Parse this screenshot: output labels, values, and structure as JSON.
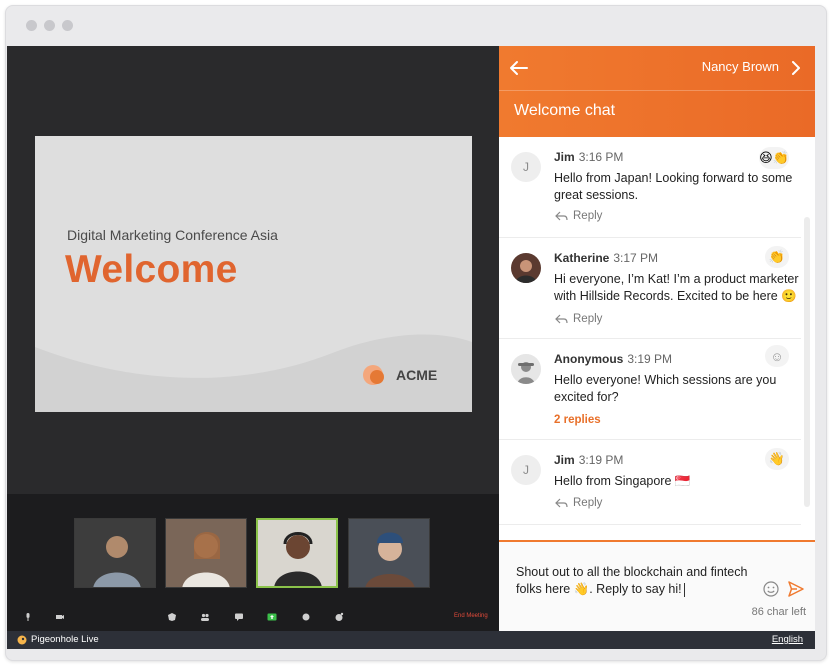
{
  "slide": {
    "subtitle": "Digital Marketing Conference Asia",
    "title": "Welcome",
    "logo_text": "ACME"
  },
  "controls": {
    "end_meeting": "End Meeting"
  },
  "footer": {
    "brand": "Pigeonhole Live",
    "language": "English"
  },
  "chat": {
    "user_name": "Nancy Brown",
    "title": "Welcome chat",
    "messages": [
      {
        "author": "Jim",
        "time": "3:16 PM",
        "avatar_letter": "J",
        "text": "Hello from Japan! Looking forward to some great sessions.",
        "action": "Reply",
        "reaction": "😆👏"
      },
      {
        "author": "Katherine",
        "time": "3:17 PM",
        "avatar_letter": "",
        "text": "Hi everyone, I’m Kat! I’m a product marketer with Hillside Records. Excited to be here 🙂",
        "action": "Reply",
        "reaction": "👏"
      },
      {
        "author": "Anonymous",
        "time": "3:19 PM",
        "avatar_letter": "",
        "text": "Hello everyone! Which sessions are you excited for?",
        "action": "2 replies",
        "reaction": "☺"
      },
      {
        "author": "Jim",
        "time": "3:19 PM",
        "avatar_letter": "J",
        "text": "Hello from Singapore 🇸🇬",
        "action": "Reply",
        "reaction": "👋"
      }
    ],
    "composer": {
      "text": "Shout out to all the blockchain and fintech folks here 👋. Reply to say hi!",
      "char_left": "86 char left"
    }
  },
  "colors": {
    "accent": "#f07a2f",
    "slide_title": "#e0652f",
    "active_thumb_border": "#8bc34a"
  }
}
